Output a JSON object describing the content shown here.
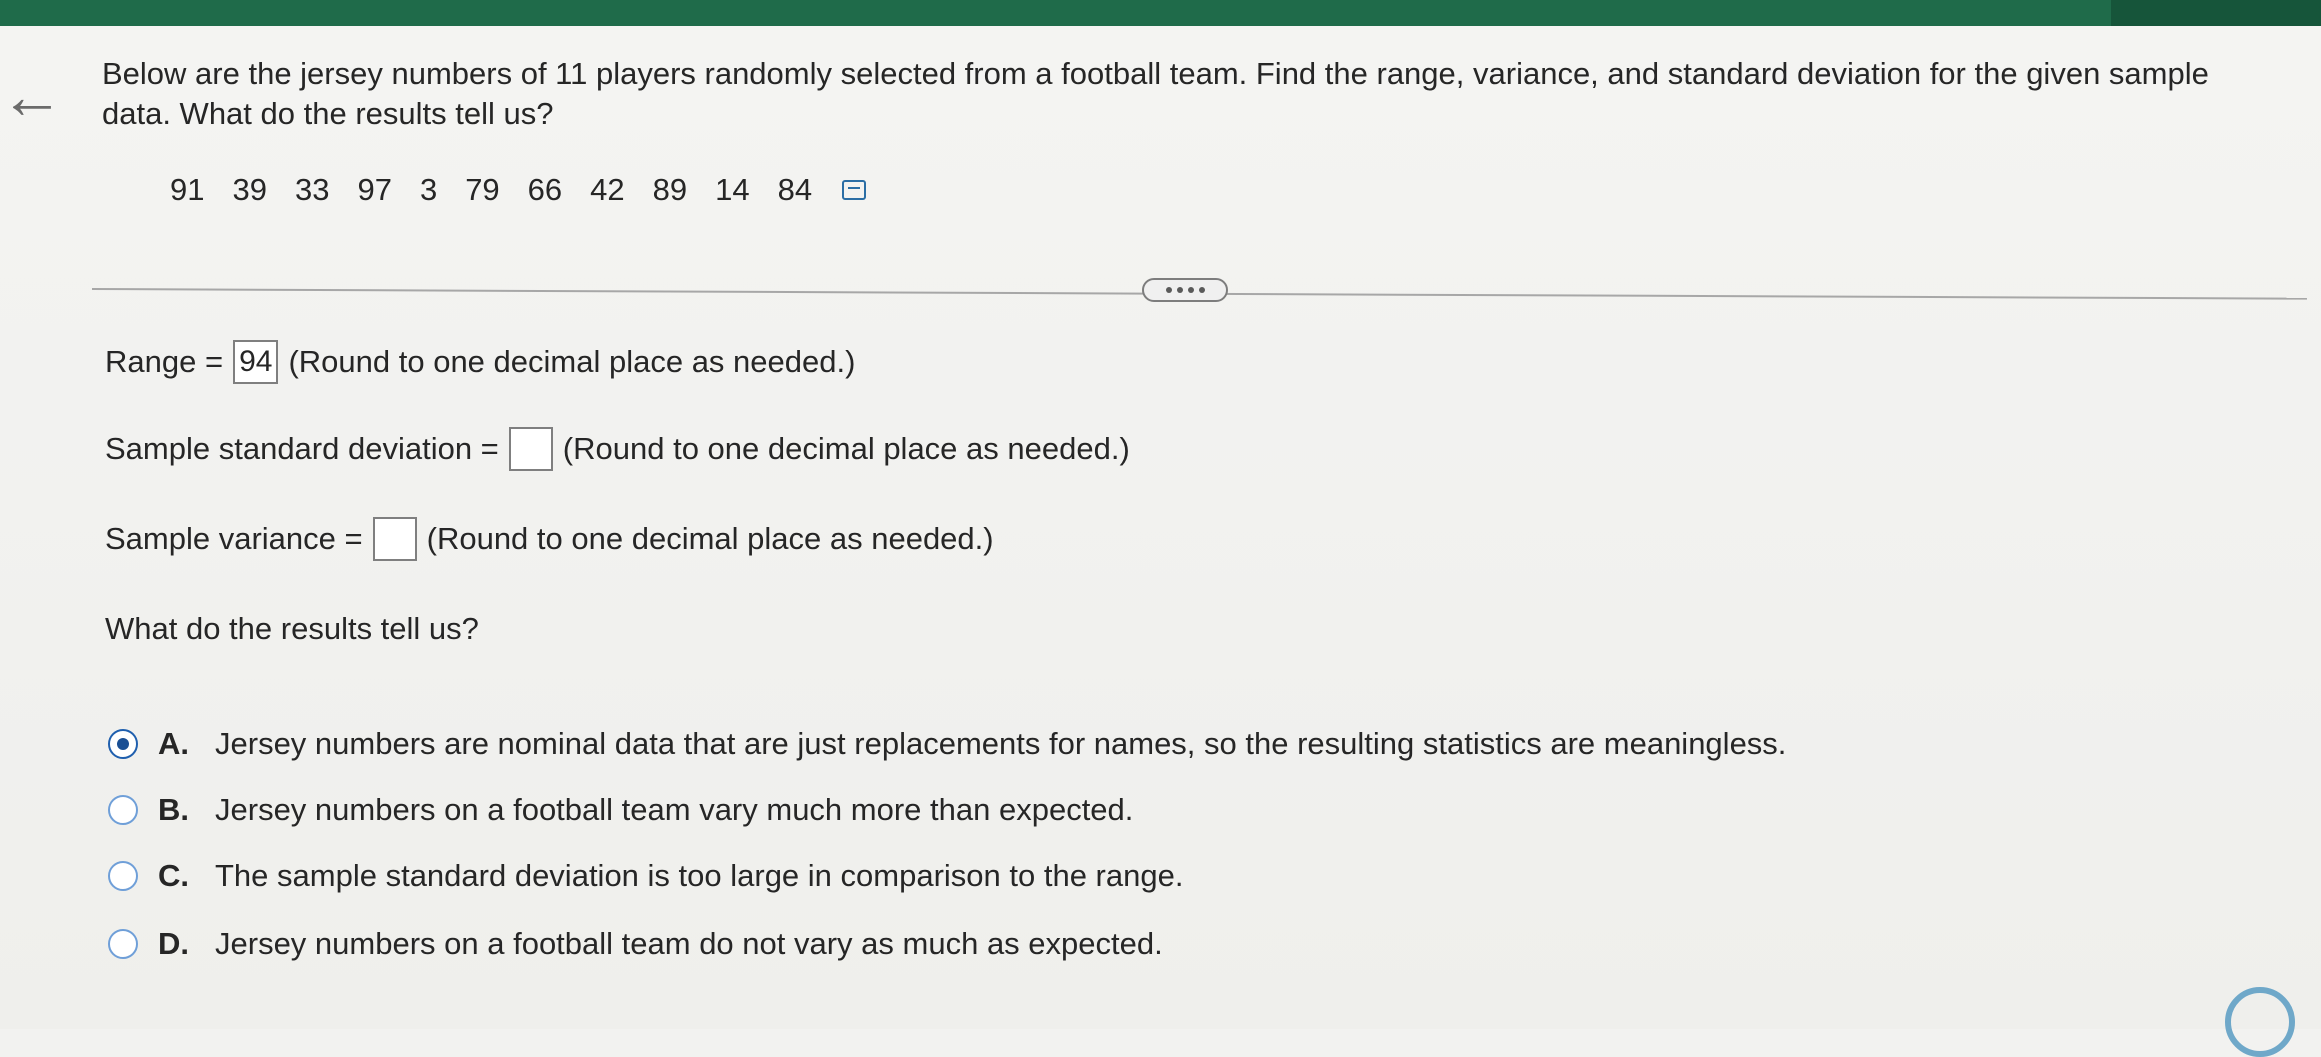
{
  "question": {
    "text": "Below are the jersey numbers of 11 players randomly selected from a football team. Find the range, variance, and standard deviation for the given sample data. What do the results tell us?"
  },
  "data_values": [
    "91",
    "39",
    "33",
    "97",
    "3",
    "79",
    "66",
    "42",
    "89",
    "14",
    "84"
  ],
  "range": {
    "label": "Range =",
    "value": "94",
    "hint": "(Round to one decimal place as needed.)"
  },
  "std_dev": {
    "label": "Sample standard deviation =",
    "value": "",
    "hint": "(Round to one decimal place as needed.)"
  },
  "variance": {
    "label": "Sample variance =",
    "value": "",
    "hint": "(Round to one decimal place as needed.)"
  },
  "results_question": "What do the results tell us?",
  "options": [
    {
      "letter": "A.",
      "text": "Jersey numbers are nominal data that are just replacements for names, so the resulting statistics are meaningless.",
      "selected": true
    },
    {
      "letter": "B.",
      "text": "Jersey numbers on a football team vary much more than expected.",
      "selected": false
    },
    {
      "letter": "C.",
      "text": "The sample standard deviation is too large in comparison to the range.",
      "selected": false
    },
    {
      "letter": "D.",
      "text": "Jersey numbers on a football team do not vary as much as expected.",
      "selected": false
    }
  ],
  "icons": {
    "back": "back-arrow-icon",
    "data_copy": "copy-data-icon",
    "expand": "more-dots-icon"
  },
  "colors": {
    "header_green": "#1f6b4a",
    "radio_selected": "#1a4f94"
  }
}
